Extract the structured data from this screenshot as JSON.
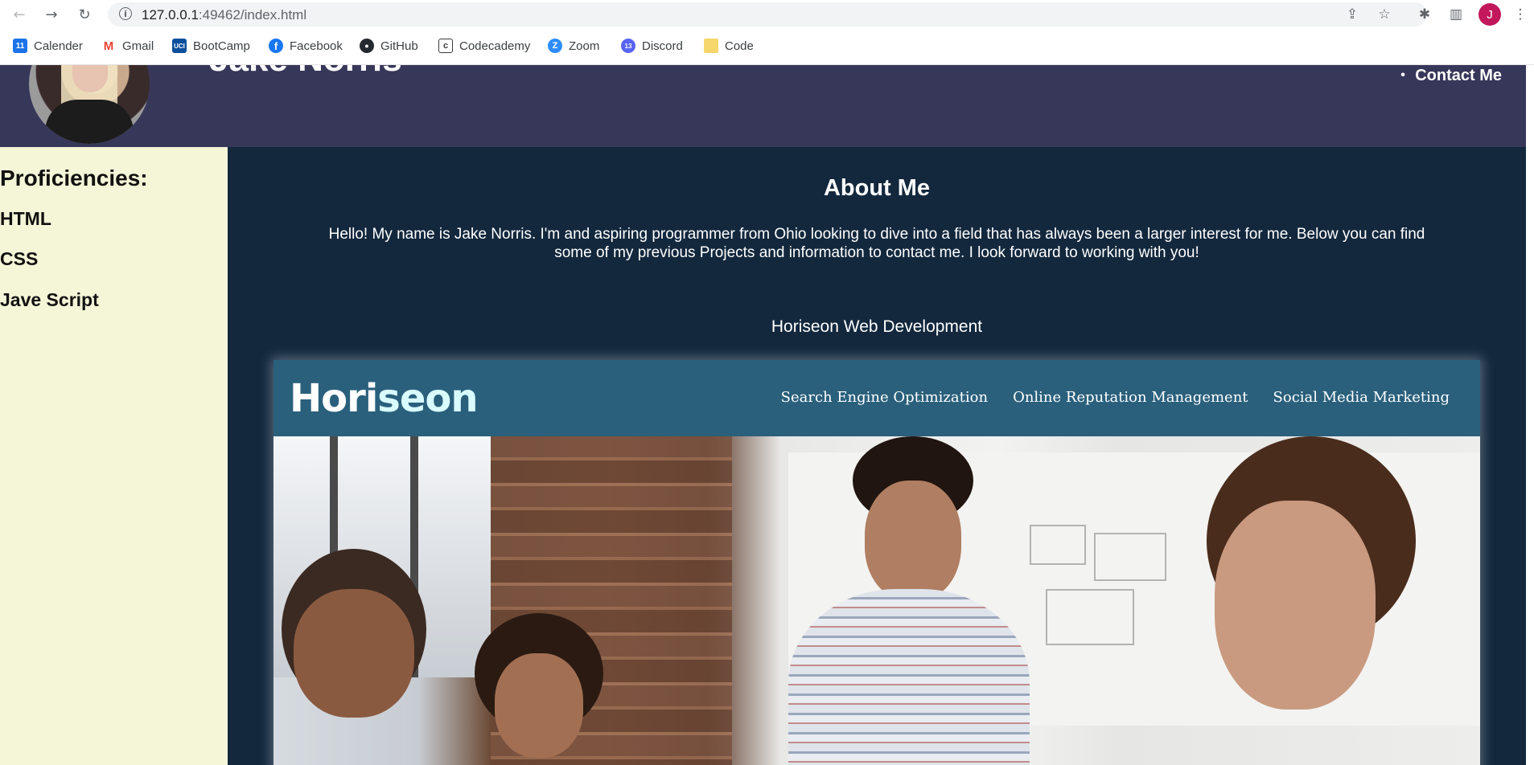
{
  "browser": {
    "url_host": "127.0.0.1",
    "url_path": ":49462/index.html",
    "profile_initial": "J",
    "bookmarks": [
      {
        "label": "Calender",
        "icon": "calendar-icon",
        "color": "#1a73e8",
        "glyph": "11"
      },
      {
        "label": "Gmail",
        "icon": "gmail-icon",
        "color": "#ea4335",
        "glyph": "M"
      },
      {
        "label": "BootCamp",
        "icon": "bootcamp-icon",
        "color": "#0b4f9c",
        "glyph": "UCI"
      },
      {
        "label": "Facebook",
        "icon": "facebook-icon",
        "color": "#1877f2",
        "glyph": "f"
      },
      {
        "label": "GitHub",
        "icon": "github-icon",
        "color": "#24292f",
        "glyph": "●"
      },
      {
        "label": "Codecademy",
        "icon": "codecademy-icon",
        "color": "#3a3a3a",
        "glyph": "c"
      },
      {
        "label": "Zoom",
        "icon": "zoom-icon",
        "color": "#2d8cff",
        "glyph": "Z"
      },
      {
        "label": "Discord",
        "icon": "discord-icon",
        "color": "#5865f2",
        "glyph": "13"
      },
      {
        "label": "Code",
        "icon": "folder-icon",
        "color": "#f6d76b",
        "glyph": ""
      }
    ]
  },
  "header": {
    "name": "Jake Norris",
    "nav": [
      "Contact Me"
    ]
  },
  "sidebar": {
    "title": "Proficiencies:",
    "skills": [
      "HTML",
      "CSS",
      "Jave Script"
    ]
  },
  "about": {
    "title": "About Me",
    "text": "Hello! My name is Jake Norris. I'm and aspiring programmer from Ohio looking to dive into a field that has always been a larger interest for me. Below you can find some of my previous Projects and information to contact me. I look forward to working with you!"
  },
  "project": {
    "title": "Horiseon Web Development",
    "logo_main": "Hori",
    "logo_accent": "seon",
    "nav": [
      "Search Engine Optimization",
      "Online Reputation Management",
      "Social Media Marketing"
    ]
  },
  "colors": {
    "header_bg": "#37375a",
    "sidebar_bg": "#f5f5d8",
    "main_bg": "#13283d",
    "project_header_bg": "#2a607c"
  }
}
